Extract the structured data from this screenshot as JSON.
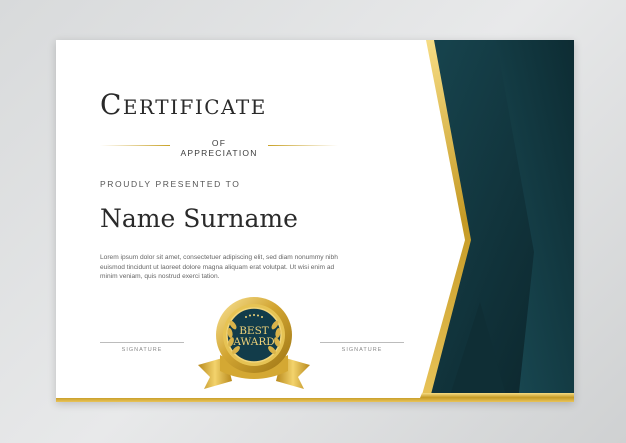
{
  "certificate": {
    "title": "Certificate",
    "subtitle": "OF APPRECIATION",
    "presented_label": "PROUDLY PRESENTED TO",
    "recipient_name": "Name Surname",
    "body_text": "Lorem ipsum dolor sit amet, consectetuer adipiscing elit, sed diam nonummy nibh euismod tincidunt ut laoreet dolore magna aliquam erat volutpat. Ut wisi enim ad minim veniam, quis nostrud exerci tation.",
    "signature_left_label": "SIGNATURE",
    "signature_right_label": "SIGNATURE"
  },
  "badge": {
    "line1": "BEST",
    "line2": "AWARD"
  },
  "colors": {
    "accent_gold": "#c9a227",
    "dark_panel": "#0f2a30",
    "badge_blue": "#123c4a",
    "background": "#dcdedf"
  },
  "icons": [
    "laurel-wreath-icon",
    "star-icon",
    "ribbon-icon"
  ]
}
